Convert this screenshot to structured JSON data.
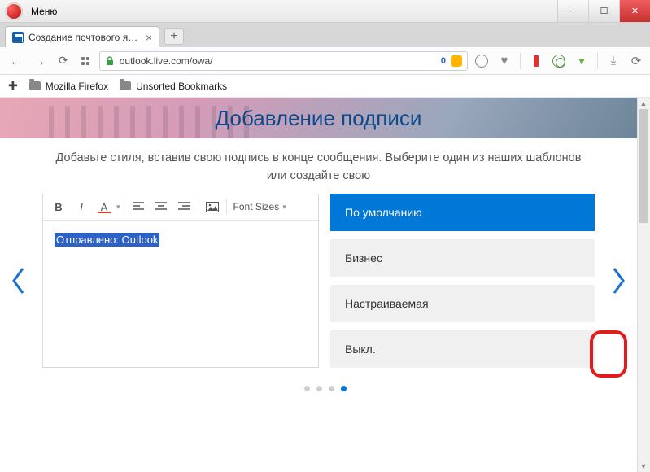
{
  "window": {
    "menu_label": "Меню"
  },
  "tab": {
    "title": "Создание почтового ящи"
  },
  "urlbar": {
    "url": "outlook.live.com/owa/",
    "badge_text": "0"
  },
  "bookmarks": {
    "folder1": "Mozilla Firefox",
    "folder2": "Unsorted Bookmarks"
  },
  "page": {
    "title": "Добавление подписи",
    "subtitle": "Добавьте стиля, вставив свою подпись в конце сообщения. Выберите один из наших шаблонов или создайте свою"
  },
  "editor": {
    "font_sizes_label": "Font Sizes",
    "text": "Отправлено: Outlook"
  },
  "templates": {
    "items": [
      "По умолчанию",
      "Бизнес",
      "Настраиваемая",
      "Выкл."
    ],
    "active_index": 0
  },
  "pager": {
    "count": 4,
    "active_index": 3
  }
}
